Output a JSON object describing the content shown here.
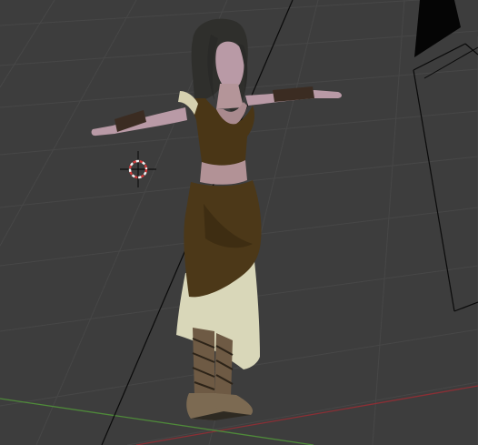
{
  "viewport": {
    "mode": "3d-viewport-perspective",
    "colors": {
      "background": "#3d3d3d",
      "grid": "#474747",
      "axis_x": "#8a2f35",
      "axis_y": "#4f8a3a",
      "wire": "#0a0a0a",
      "cursor_red": "#d23a3a",
      "cursor_white": "#f2f2f2"
    },
    "scene": {
      "character": {
        "pose": "T-pose",
        "outfit": [
          "bodice",
          "skirt",
          "sandals",
          "bracers"
        ],
        "colors": {
          "skin": "#b99aa6",
          "hair": "#2f2f2c",
          "bodice": "#4a3616",
          "skirt_over": "#4c3818",
          "skirt_under": "#d9d7b9",
          "boots": "#6e5a44",
          "bracer": "#3b2c22"
        }
      },
      "camera_object": {
        "icon": "camera-wireframe-icon"
      },
      "cursor_3d": {
        "icon": "3d-cursor-icon"
      }
    }
  }
}
